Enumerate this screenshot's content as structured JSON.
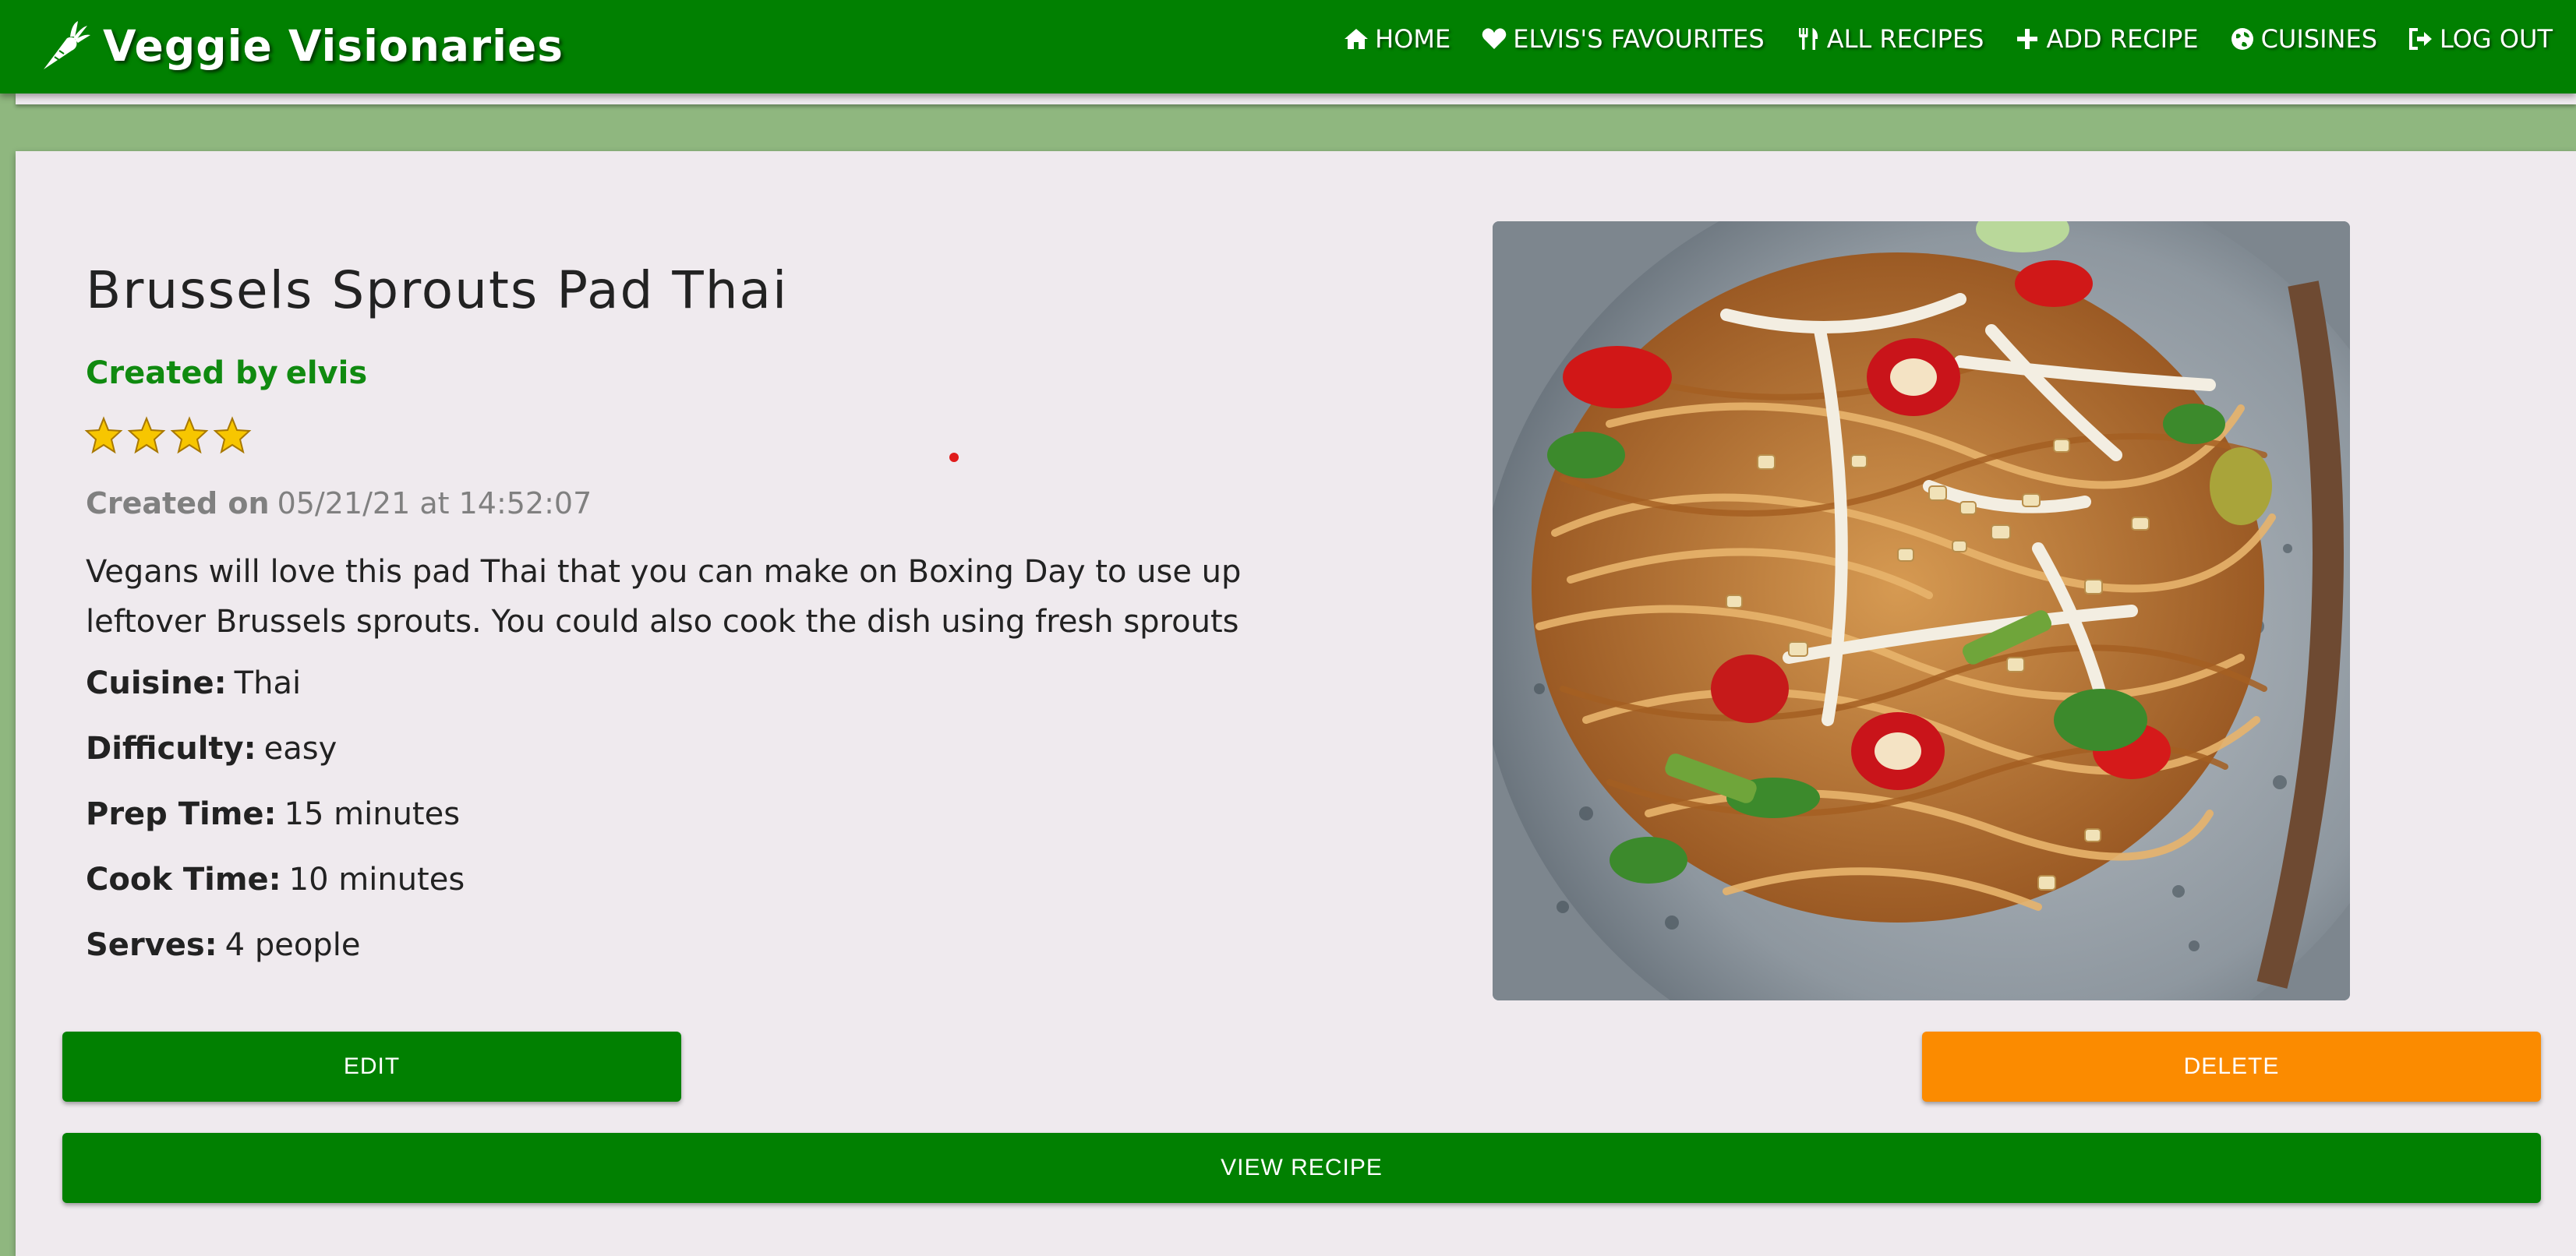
{
  "brand": {
    "name": "Veggie Visionaries",
    "icon": "carrot-icon"
  },
  "nav": [
    {
      "label": "HOME",
      "icon": "home-icon"
    },
    {
      "label": "ELVIS'S FAVOURITES",
      "icon": "heart-icon"
    },
    {
      "label": "ALL RECIPES",
      "icon": "utensils-icon"
    },
    {
      "label": "ADD RECIPE",
      "icon": "plus-icon"
    },
    {
      "label": "CUISINES",
      "icon": "globe-icon"
    },
    {
      "label": "LOG OUT",
      "icon": "sign-out-icon"
    }
  ],
  "recipe": {
    "title": "Brussels Sprouts Pad Thai",
    "created_by_label": "Created by",
    "author": "elvis",
    "rating": 4,
    "created_on_label": "Created on",
    "created_on_value": "05/21/21 at 14:52:07",
    "description": "Vegans will love this pad Thai that you can make on Boxing Day to use up leftover Brussels sprouts. You could also cook the dish using fresh sprouts",
    "details": [
      {
        "label": "Cuisine:",
        "value": "Thai"
      },
      {
        "label": "Difficulty:",
        "value": "easy"
      },
      {
        "label": "Prep Time:",
        "value": "15 minutes"
      },
      {
        "label": "Cook Time:",
        "value": "10 minutes"
      },
      {
        "label": "Serves:",
        "value": "4 people"
      }
    ],
    "image_alt": "Brussels Sprouts Pad Thai"
  },
  "actions": {
    "edit_label": "EDIT",
    "delete_label": "DELETE",
    "view_label": "VIEW RECIPE"
  },
  "colors": {
    "navbar": "#018001",
    "brand_green": "#108a10",
    "edit_button": "#018001",
    "delete_button": "#fb8b00",
    "card_background": "#efeaee",
    "page_background": "#8fb77f"
  }
}
